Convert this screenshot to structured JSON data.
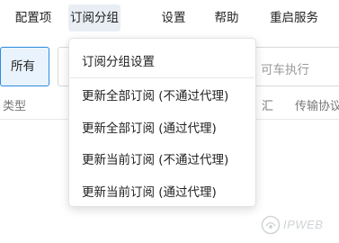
{
  "menubar": {
    "items": [
      {
        "label": "配置项"
      },
      {
        "label": "订阅分组"
      },
      {
        "label": "设置"
      },
      {
        "label": "帮助"
      },
      {
        "label": "重启服务"
      }
    ],
    "active_index": 1
  },
  "toolbar": {
    "filter_all_label": "所有",
    "search_visible_text": "可车执行"
  },
  "table": {
    "columns": [
      "类型",
      "汇",
      "传输协议"
    ]
  },
  "dropdown": {
    "items": [
      {
        "label": "订阅分组设置"
      },
      {
        "label": "更新全部订阅 (不通过代理)"
      },
      {
        "label": "更新全部订阅 (通过代理)"
      },
      {
        "label": "更新当前订阅 (不通过代理)"
      },
      {
        "label": "更新当前订阅 (通过代理)"
      }
    ]
  },
  "watermark": {
    "text": "IPWEB"
  },
  "colors": {
    "accent": "#2b8ae0",
    "active_menu_bg": "#e9eef4",
    "selected_filter_bg": "#e9f3fd"
  }
}
